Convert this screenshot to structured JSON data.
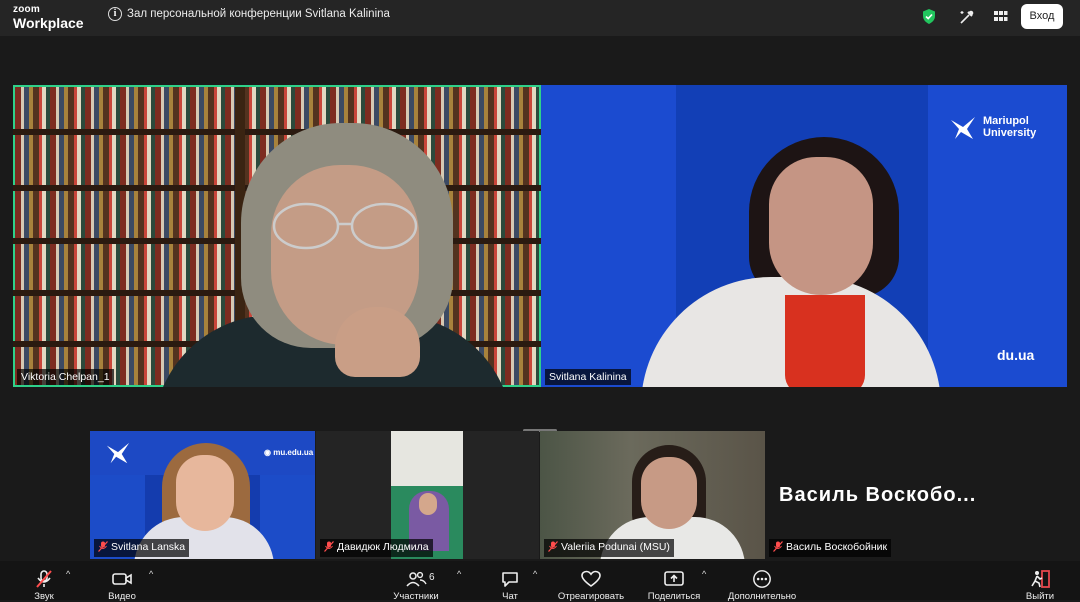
{
  "app": {
    "brand_top": "zoom",
    "brand_bottom": "Workplace"
  },
  "header": {
    "meeting_title": "Зал персональной конференции Svitlana Kalinina",
    "signin_label": "Вход",
    "info_icon": "i"
  },
  "participants": {
    "p1": {
      "name": "Viktoria Chelpan_1",
      "active_speaker": true
    },
    "p2": {
      "name": "Svitlana Kalinina",
      "logo_line1": "Mariupol",
      "logo_line2": "University",
      "url_fragment": "du.ua"
    },
    "p3": {
      "name": "Svitlana Lanska",
      "muted": true,
      "url": "mu.edu.ua"
    },
    "p4": {
      "name": "Давидюк Людмила",
      "muted": true
    },
    "p5": {
      "name": "Valeriia Podunai (MSU)",
      "muted": true
    },
    "p6": {
      "name": "Василь Воскобойник",
      "muted": true,
      "display_text": "Василь Воскобо..."
    }
  },
  "toolbar": {
    "audio_label": "Звук",
    "video_label": "Видео",
    "participants_label": "Участники",
    "participants_count": "6",
    "chat_label": "Чат",
    "react_label": "Отреагировать",
    "share_label": "Поделиться",
    "more_label": "Дополнительно",
    "leave_label": "Выйти"
  },
  "colors": {
    "active_speaker_border": "#2fd18a",
    "brand_blue": "#1f50c8",
    "shield": "#22c55e",
    "leave_red": "#e5484d",
    "mute_red": "#ff4d4d"
  }
}
